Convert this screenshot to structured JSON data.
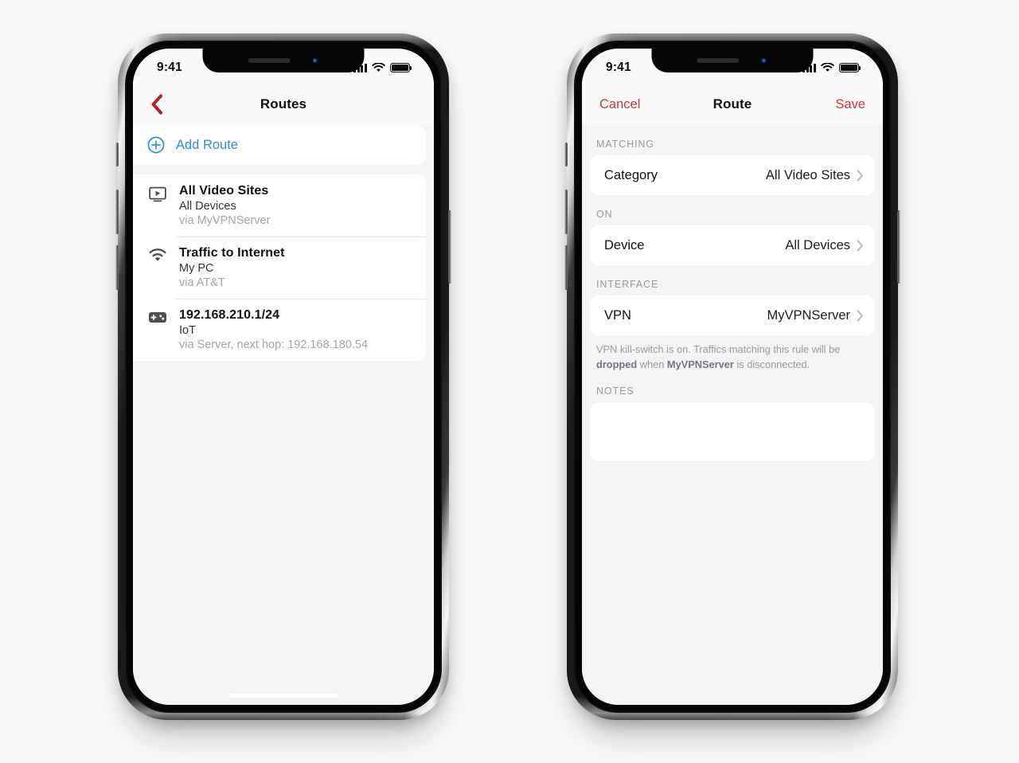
{
  "background_color": "#f7f7f7",
  "accent_blue": "#2b8fe0",
  "accent_red": "#c6392f",
  "phones": [
    {
      "id": "routes-list",
      "status_bar": {
        "time": "9:41",
        "signal_icon": "cellular-signal-icon",
        "wifi_icon": "wifi-icon",
        "battery_icon": "battery-icon"
      },
      "nav": {
        "back_icon": "back-chevron-icon",
        "title": "Routes"
      },
      "add_route": {
        "icon": "plus-circle-icon",
        "label": "Add Route"
      },
      "routes": [
        {
          "icon": "tv-play-icon",
          "title": "All Video Sites",
          "subtitle": "All Devices",
          "via": "via MyVPNServer"
        },
        {
          "icon": "wifi-icon",
          "title": "Traffic to Internet",
          "subtitle": "My PC",
          "via": "via AT&T"
        },
        {
          "icon": "gamepad-icon",
          "title": "192.168.210.1/24",
          "subtitle": "IoT",
          "via": "via Server, next hop: 192.168.180.54"
        }
      ]
    },
    {
      "id": "route-detail",
      "status_bar": {
        "time": "9:41",
        "signal_icon": "cellular-signal-icon",
        "wifi_icon": "wifi-icon",
        "battery_icon": "battery-icon"
      },
      "nav": {
        "cancel_label": "Cancel",
        "title": "Route",
        "save_label": "Save"
      },
      "sections": [
        {
          "header": "MATCHING",
          "row": {
            "label": "Category",
            "value": "All Video Sites",
            "chevron_icon": "chevron-right-icon"
          }
        },
        {
          "header": "ON",
          "row": {
            "label": "Device",
            "value": "All Devices",
            "chevron_icon": "chevron-right-icon"
          }
        },
        {
          "header": "INTERFACE",
          "row": {
            "label": "VPN",
            "value": "MyVPNServer",
            "chevron_icon": "chevron-right-icon"
          }
        }
      ],
      "footnote": {
        "part1": "VPN kill-switch is on. Traffics matching this rule will be ",
        "bold1": "dropped",
        "part2": " when ",
        "bold2": "MyVPNServer",
        "part3": " is disconnected."
      },
      "notes": {
        "header": "NOTES",
        "value": "",
        "placeholder": ""
      }
    }
  ]
}
